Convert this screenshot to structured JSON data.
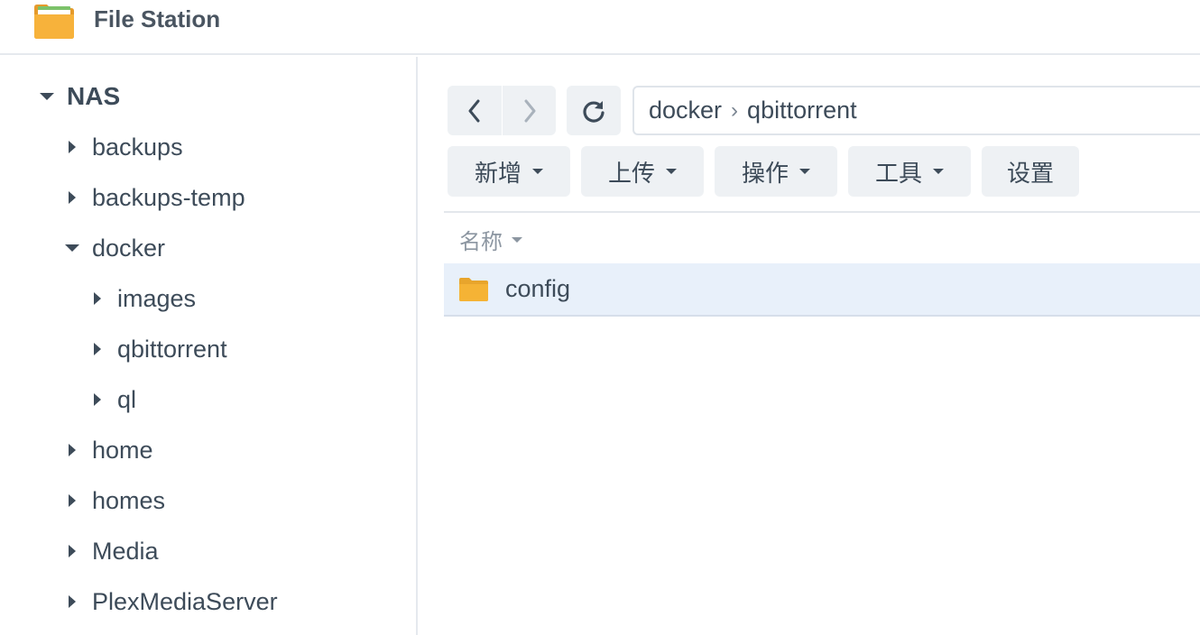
{
  "app": {
    "title": "File Station"
  },
  "sidebar": {
    "root": "NAS",
    "items": [
      {
        "label": "backups",
        "level": 1,
        "expanded": false,
        "selected": false
      },
      {
        "label": "backups-temp",
        "level": 1,
        "expanded": false,
        "selected": false
      },
      {
        "label": "docker",
        "level": 1,
        "expanded": true,
        "selected": false
      },
      {
        "label": "images",
        "level": 2,
        "expanded": false,
        "selected": false
      },
      {
        "label": "qbittorrent",
        "level": 2,
        "expanded": false,
        "selected": true
      },
      {
        "label": "ql",
        "level": 2,
        "expanded": false,
        "selected": false
      },
      {
        "label": "home",
        "level": 1,
        "expanded": false,
        "selected": false
      },
      {
        "label": "homes",
        "level": 1,
        "expanded": false,
        "selected": false
      },
      {
        "label": "Media",
        "level": 1,
        "expanded": false,
        "selected": false
      },
      {
        "label": "PlexMediaServer",
        "level": 1,
        "expanded": false,
        "selected": false
      }
    ]
  },
  "path": {
    "segments": [
      "docker",
      "qbittorrent"
    ]
  },
  "toolbar": {
    "create": "新增",
    "upload": "上传",
    "action": "操作",
    "tools": "工具",
    "settings": "设置"
  },
  "list": {
    "column_name": "名称",
    "rows": [
      {
        "name": "config",
        "type": "folder"
      }
    ]
  },
  "icons": {
    "app": "folder-app-icon",
    "back": "chevron-left-icon",
    "forward": "chevron-right-icon",
    "refresh": "refresh-icon",
    "folder": "folder-icon"
  },
  "colors": {
    "accent_selection": "#e7eff9",
    "folder": "#f5b335",
    "button_bg": "#eef1f4"
  }
}
